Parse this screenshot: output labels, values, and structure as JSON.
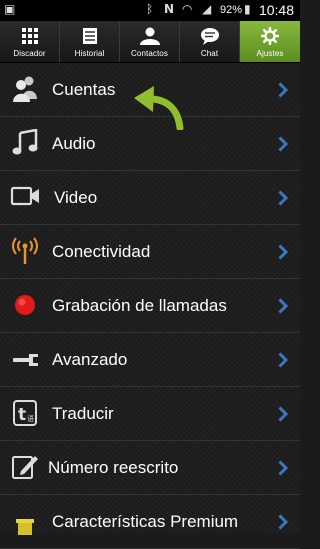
{
  "status_bar": {
    "battery_percent": "92%",
    "time": "10:48"
  },
  "tabs": [
    {
      "id": "discador",
      "label": "Discador",
      "icon": "dialpad-icon",
      "active": false
    },
    {
      "id": "historial",
      "label": "Historial",
      "icon": "history-icon",
      "active": false
    },
    {
      "id": "contactos",
      "label": "Contactos",
      "icon": "contacts-icon",
      "active": false
    },
    {
      "id": "chat",
      "label": "Chat",
      "icon": "chat-bubble-icon",
      "active": false
    },
    {
      "id": "ajustes",
      "label": "Ajustes",
      "icon": "gear-icon",
      "active": true
    }
  ],
  "settings": [
    {
      "label": "Cuentas",
      "icon": "accounts-icon"
    },
    {
      "label": "Audio",
      "icon": "music-note-icon"
    },
    {
      "label": "Video",
      "icon": "video-camera-icon"
    },
    {
      "label": "Conectividad",
      "icon": "antenna-icon"
    },
    {
      "label": "Grabación de llamadas",
      "icon": "record-icon"
    },
    {
      "label": "Avanzado",
      "icon": "wrench-icon"
    },
    {
      "label": "Traducir",
      "icon": "translate-icon"
    },
    {
      "label": "Número reescrito",
      "icon": "edit-icon"
    },
    {
      "label": "Características Premium",
      "icon": "premium-icon"
    }
  ],
  "colors": {
    "accent_green": "#7fb331",
    "chevron_blue": "#3a78c3",
    "record_red": "#e01b1b"
  }
}
